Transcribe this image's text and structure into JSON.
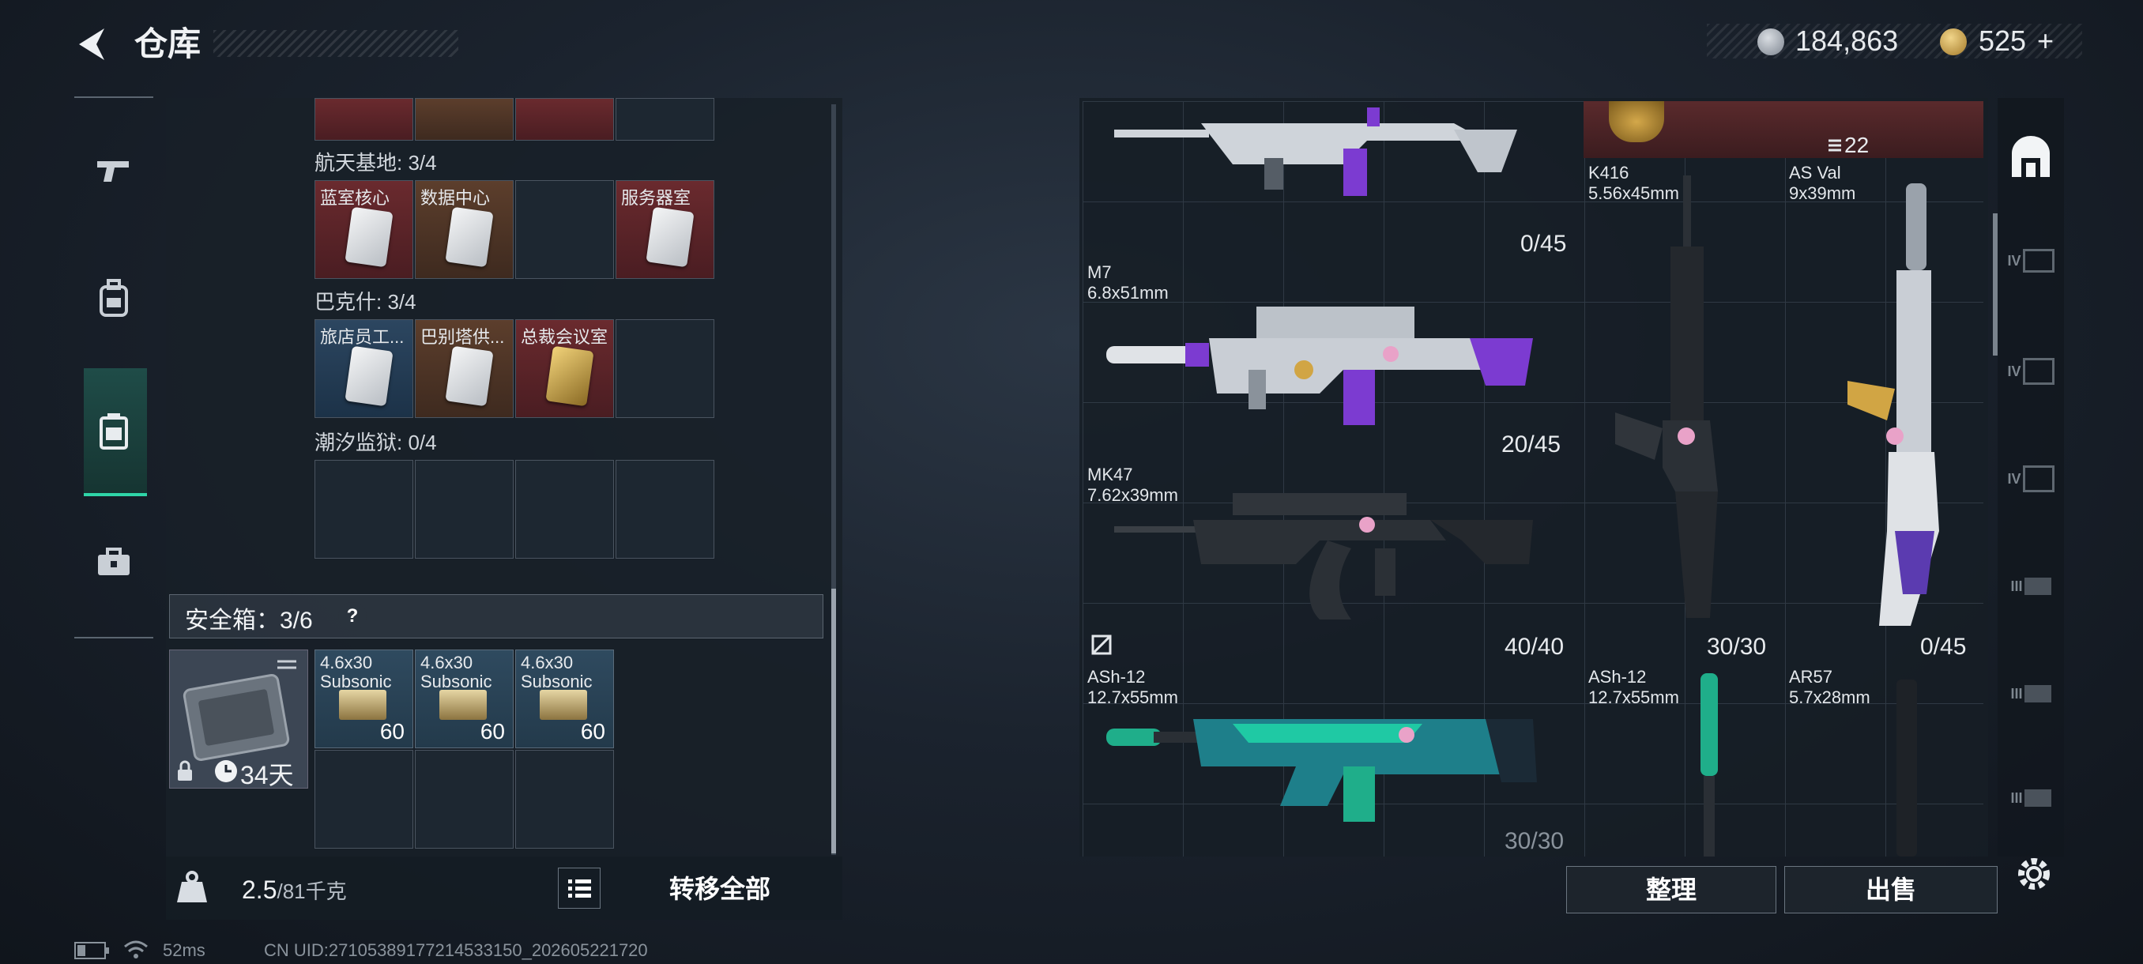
{
  "header": {
    "title": "仓库",
    "currency_silver": "184,863",
    "currency_gold": "525",
    "currency_add": "+"
  },
  "left_panel": {
    "sections": [
      {
        "label": "航天基地: 3/4",
        "cells": [
          {
            "name": "蓝室核心",
            "style": "red"
          },
          {
            "name": "数据中心",
            "style": "brown"
          },
          {
            "name": "",
            "style": "empty"
          },
          {
            "name": "服务器室",
            "style": "red"
          }
        ]
      },
      {
        "label": "巴克什: 3/4",
        "cells": [
          {
            "name": "旅店员工...",
            "style": "blue"
          },
          {
            "name": "巴别塔供...",
            "style": "brown"
          },
          {
            "name": "总裁会议室",
            "style": "red"
          },
          {
            "name": "",
            "style": "empty"
          }
        ]
      },
      {
        "label": "潮汐监狱: 0/4",
        "cells": []
      }
    ],
    "safe_box": {
      "title": "安全箱：3/6",
      "help": "?",
      "duration": "34天",
      "ammo": [
        {
          "caliber": "4.6x30",
          "type": "Subsonic",
          "count": "60"
        },
        {
          "caliber": "4.6x30",
          "type": "Subsonic",
          "count": "60"
        },
        {
          "caliber": "4.6x30",
          "type": "Subsonic",
          "count": "60"
        }
      ]
    },
    "weight_value": "2.5",
    "weight_max": "/81千克",
    "transfer_all": "转移全部"
  },
  "right_panel": {
    "weapons": [
      {
        "name": "",
        "caliber": "",
        "count": "0/45"
      },
      {
        "name": "M7",
        "caliber": "6.8x51mm",
        "count": "20/45"
      },
      {
        "name": "MK47",
        "caliber": "7.62x39mm",
        "count": "40/40"
      },
      {
        "name": "ASh-12",
        "caliber": "12.7x55mm",
        "count": "30/30"
      },
      {
        "name": "K416",
        "caliber": "5.56x45mm",
        "count": "30/30"
      },
      {
        "name": "AS Val",
        "caliber": "9x39mm",
        "count": "0/45"
      },
      {
        "name": "ASh-12",
        "caliber": "12.7x55mm",
        "count": ""
      },
      {
        "name": "AR57",
        "caliber": "5.7x28mm",
        "count": ""
      }
    ],
    "top_item_count": "22",
    "tidy": "整理",
    "sell": "出售",
    "side_tabs": [
      "IV",
      "IV",
      "IV",
      "III",
      "III",
      "III"
    ]
  },
  "status": {
    "ping": "52ms",
    "uid": "CN UID:27105389177214533150_202605221720"
  }
}
